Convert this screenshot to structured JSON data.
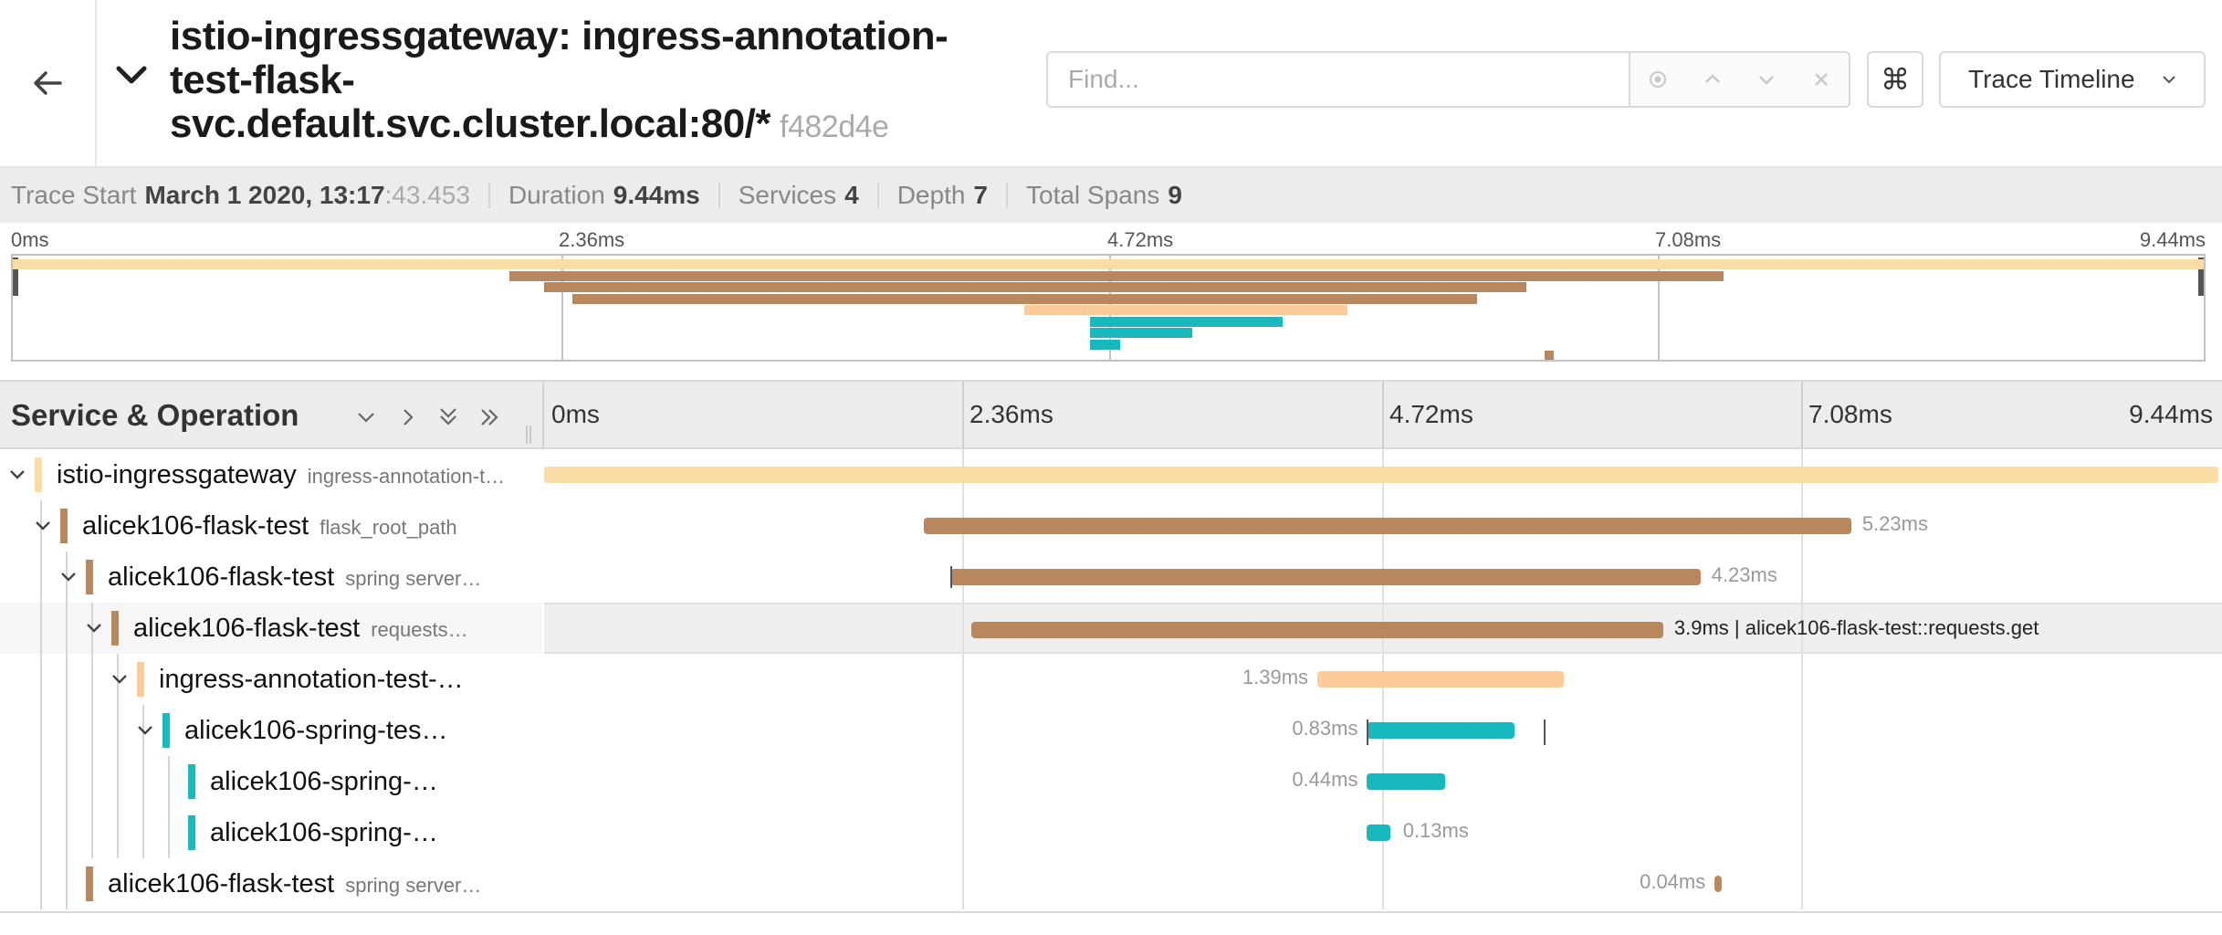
{
  "header": {
    "title": "istio-ingressgateway: ingress-annotation-test-flask-svc.default.svc.cluster.local:80/*",
    "trace_id": "f482d4e",
    "find_placeholder": "Find...",
    "keyboard_shortcut_glyph": "⌘",
    "view_selector": "Trace Timeline"
  },
  "summary": {
    "trace_start_label": "Trace Start",
    "trace_start_date": "March 1 2020, 13:17",
    "trace_start_ms": ":43.453",
    "duration_label": "Duration",
    "duration": "9.44ms",
    "services_label": "Services",
    "services": "4",
    "depth_label": "Depth",
    "depth": "7",
    "total_spans_label": "Total Spans",
    "total_spans": "9"
  },
  "ticks": [
    "0ms",
    "2.36ms",
    "4.72ms",
    "7.08ms",
    "9.44ms"
  ],
  "timeline": {
    "column_title": "Service & Operation",
    "total_ms": 9.44
  },
  "colors": {
    "istio": "#f9dda4",
    "flask": "#b9875e",
    "ingress": "#fdcb9a",
    "spring": "#17b8be"
  },
  "spans": [
    {
      "service": "istio-ingressgateway",
      "operation": "ingress-annotation-t…",
      "color": "#f9dda4",
      "depth": 0,
      "has_children": true,
      "start_ms": 0.0,
      "duration_ms": 9.44,
      "label": ""
    },
    {
      "service": "alicek106-flask-test",
      "operation": "flask_root_path",
      "color": "#b9875e",
      "depth": 1,
      "has_children": true,
      "start_ms": 2.14,
      "duration_ms": 5.23,
      "label": "5.23ms"
    },
    {
      "service": "alicek106-flask-test",
      "operation": "spring server…",
      "color": "#b9875e",
      "depth": 2,
      "has_children": true,
      "start_ms": 2.29,
      "duration_ms": 4.23,
      "label": "4.23ms"
    },
    {
      "service": "alicek106-flask-test",
      "operation": "requests…",
      "color": "#b9875e",
      "depth": 3,
      "has_children": true,
      "start_ms": 2.41,
      "duration_ms": 3.9,
      "label": "3.9ms | alicek106-flask-test::requests.get",
      "highlighted": true
    },
    {
      "service": "ingress-annotation-test-…",
      "operation": "",
      "color": "#fdcb9a",
      "depth": 4,
      "has_children": true,
      "start_ms": 4.36,
      "duration_ms": 1.39,
      "label": "1.39ms"
    },
    {
      "service": "alicek106-spring-tes…",
      "operation": "",
      "color": "#17b8be",
      "depth": 5,
      "has_children": true,
      "start_ms": 4.64,
      "duration_ms": 0.83,
      "label": "0.83ms"
    },
    {
      "service": "alicek106-spring-…",
      "operation": "",
      "color": "#17b8be",
      "depth": 6,
      "has_children": false,
      "start_ms": 4.64,
      "duration_ms": 0.44,
      "label": "0.44ms"
    },
    {
      "service": "alicek106-spring-…",
      "operation": "",
      "color": "#17b8be",
      "depth": 6,
      "has_children": false,
      "start_ms": 4.64,
      "duration_ms": 0.13,
      "label": "0.13ms"
    },
    {
      "service": "alicek106-flask-test",
      "operation": "spring server…",
      "color": "#b9875e",
      "depth": 2,
      "has_children": false,
      "start_ms": 6.6,
      "duration_ms": 0.04,
      "label": "0.04ms"
    }
  ]
}
